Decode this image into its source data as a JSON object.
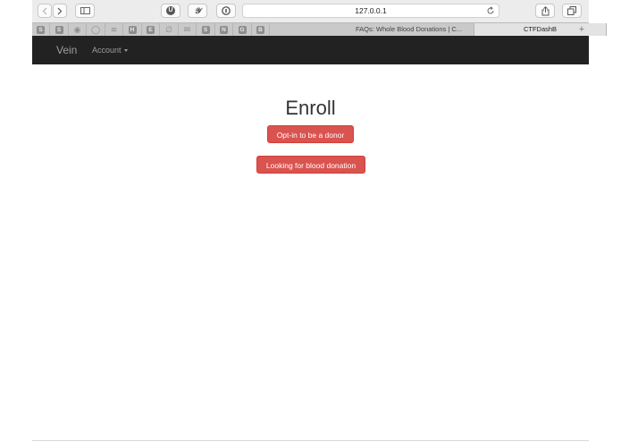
{
  "browser": {
    "url": "127.0.0.1",
    "pinned_tabs": [
      {
        "icon": "s-icon",
        "glyph": "S"
      },
      {
        "icon": "s-icon",
        "glyph": "S"
      },
      {
        "icon": "messenger-icon",
        "glyph": "◉"
      },
      {
        "icon": "github-icon",
        "glyph": "◯"
      },
      {
        "icon": "stack-icon",
        "glyph": "≋"
      },
      {
        "icon": "h-icon",
        "glyph": "H"
      },
      {
        "icon": "e-icon",
        "glyph": "E"
      },
      {
        "icon": "leaf-icon",
        "glyph": "∅"
      },
      {
        "icon": "mail-icon",
        "glyph": "✉"
      },
      {
        "icon": "s-icon",
        "glyph": "S"
      },
      {
        "icon": "n-icon",
        "glyph": "N"
      },
      {
        "icon": "g-icon",
        "glyph": "G"
      },
      {
        "icon": "b-icon",
        "glyph": "B"
      }
    ],
    "tabs": [
      {
        "label": "FAQs: Whole Blood Donations | C...",
        "active": false
      },
      {
        "label": "CTFDashB",
        "active": true
      }
    ]
  },
  "navbar": {
    "brand": "Vein",
    "account_label": "Account"
  },
  "main": {
    "title": "Enroll",
    "donor_button": "Opt-in to be a donor",
    "looking_button": "Looking for blood donation"
  },
  "colors": {
    "navbar_bg": "#222222",
    "danger": "#d9534f"
  }
}
